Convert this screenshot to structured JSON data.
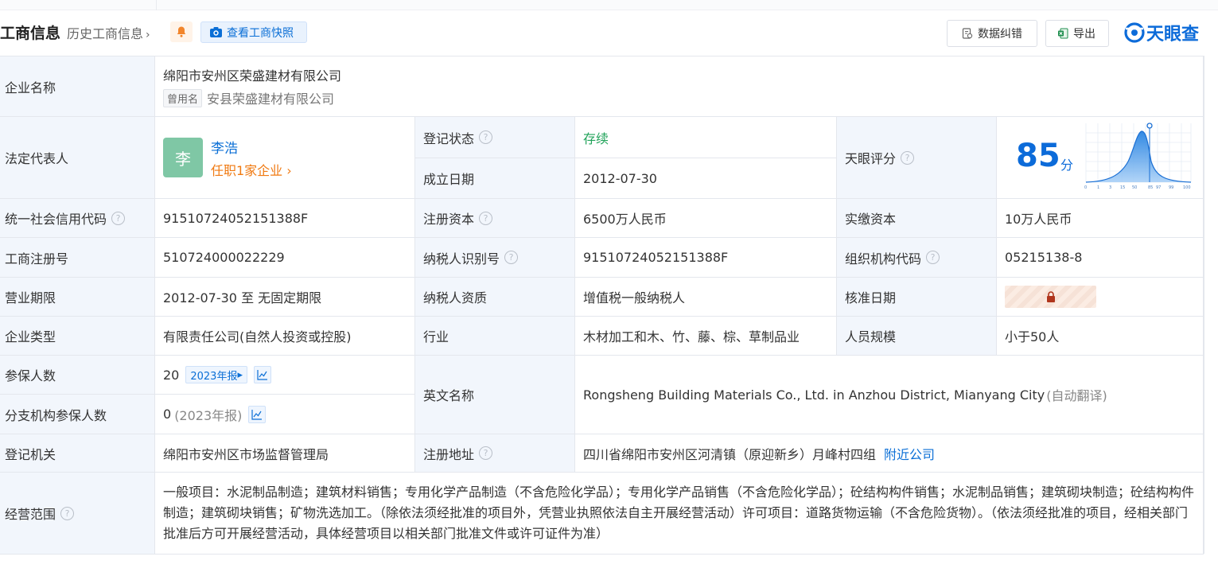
{
  "header": {
    "title": "工商信息",
    "history_link": "历史工商信息",
    "snapshot_label": "查看工商快照",
    "fix_label": "数据纠错",
    "export_label": "导出",
    "logo_text": "天眼查"
  },
  "company": {
    "name_label": "企业名称",
    "name": "绵阳市安州区荣盛建材有限公司",
    "former_tag": "曾用名",
    "former_name": "安县荣盛建材有限公司"
  },
  "legal_rep": {
    "label": "法定代表人",
    "avatar_char": "李",
    "name": "李浩",
    "jobs": "任职1家企业"
  },
  "status": {
    "label": "登记状态",
    "value": "存续"
  },
  "established": {
    "label": "成立日期",
    "value": "2012-07-30"
  },
  "score": {
    "label": "天眼评分",
    "value": "85",
    "unit": "分",
    "ticks": [
      "0",
      "1",
      "3",
      "15",
      "50",
      "85",
      "97",
      "99",
      "100"
    ]
  },
  "rows": {
    "credit_code_label": "统一社会信用代码",
    "credit_code": "91510724052151388F",
    "reg_capital_label": "注册资本",
    "reg_capital": "6500万人民币",
    "paid_capital_label": "实缴资本",
    "paid_capital": "10万人民币",
    "reg_no_label": "工商注册号",
    "reg_no": "510724000022229",
    "taxpayer_id_label": "纳税人识别号",
    "taxpayer_id": "91510724052151388F",
    "org_code_label": "组织机构代码",
    "org_code": "05215138-8",
    "term_label": "营业期限",
    "term": "2012-07-30 至 无固定期限",
    "tax_qual_label": "纳税人资质",
    "tax_qual": "增值税一般纳税人",
    "approve_date_label": "核准日期",
    "type_label": "企业类型",
    "type": "有限责任公司(自然人投资或控股)",
    "industry_label": "行业",
    "industry": "木材加工和木、竹、藤、棕、草制品业",
    "staff_label": "人员规模",
    "staff": "小于50人",
    "insured_label": "参保人数",
    "insured": "20",
    "insured_report": "2023年报",
    "branch_insured_label": "分支机构参保人数",
    "branch_insured": "0",
    "branch_insured_note": "(2023年报)",
    "en_name_label": "英文名称",
    "en_name": "Rongsheng Building Materials Co., Ltd. in Anzhou District, Mianyang City",
    "en_name_note": "(自动翻译)",
    "authority_label": "登记机关",
    "authority": "绵阳市安州区市场监督管理局",
    "address_label": "注册地址",
    "address": "四川省绵阳市安州区河清镇（原迎新乡）月峰村四组",
    "nearby": "附近公司",
    "scope_label": "经营范围",
    "scope": "一般项目：水泥制品制造；建筑材料销售；专用化学产品制造（不含危险化学品）；专用化学产品销售（不含危险化学品）；砼结构构件销售；水泥制品销售；建筑砌块制造；砼结构构件制造；建筑砌块销售；矿物洗选加工。（除依法须经批准的项目外，凭营业执照依法自主开展经营活动）许可项目：道路货物运输（不含危险货物）。（依法须经批准的项目，经相关部门批准后方可开展经营活动，具体经营项目以相关部门批准文件或许可证件为准）"
  },
  "colors": {
    "accent": "#0b6fd6",
    "label_bg": "#f2f6fc",
    "status_green": "#21a35a",
    "job_orange": "#f07a12"
  }
}
